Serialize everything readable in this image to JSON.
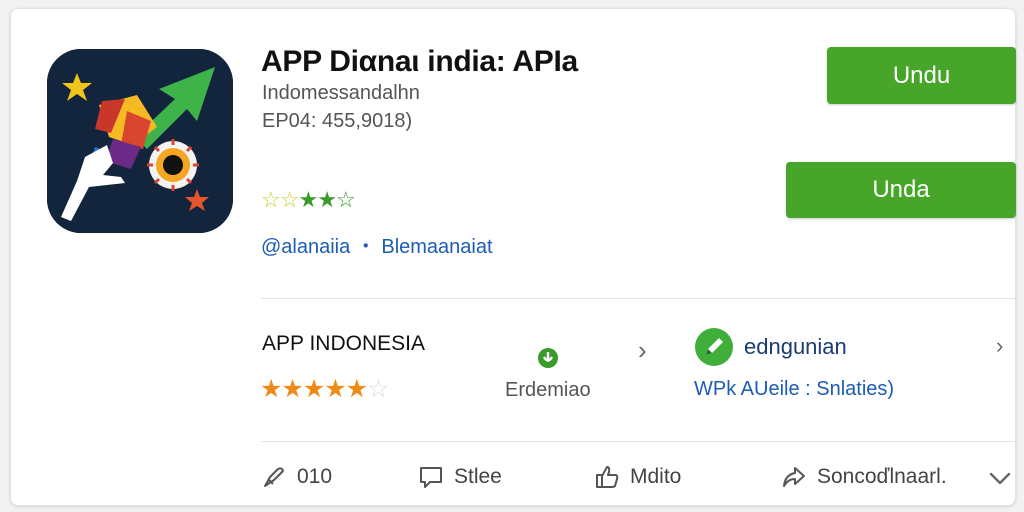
{
  "app": {
    "title": "APP Diαnaι india: APIa",
    "developer": "Indomessandalhn",
    "meta": "EP04: 455,9018)",
    "rating_stars": "☆☆★★☆",
    "tags": "@alanaiia ・ Blemaanaiat"
  },
  "buttons": {
    "primary": "Undu",
    "secondary": "Unda"
  },
  "publisher": {
    "name": "APP INDONESIA",
    "stars_filled": "★★★★★",
    "star_empty": "☆",
    "rating_value": 4.5,
    "editor_label": "Erdemiao"
  },
  "verified": {
    "name": "edngunian",
    "subtitle": "WPk AUeile : Snlaties)"
  },
  "actions": [
    {
      "label": "010",
      "icon": "share-icon"
    },
    {
      "label": "Stlee",
      "icon": "comment-icon"
    },
    {
      "label": "Mdito",
      "icon": "thumbs-up-icon"
    },
    {
      "label": "Soncoďlnaarl.",
      "icon": "forward-icon"
    }
  ],
  "colors": {
    "accent_green": "#47a62a",
    "link_blue": "#1d5cb4",
    "star_orange": "#ee8a16",
    "icon_bg": "#13243d"
  }
}
